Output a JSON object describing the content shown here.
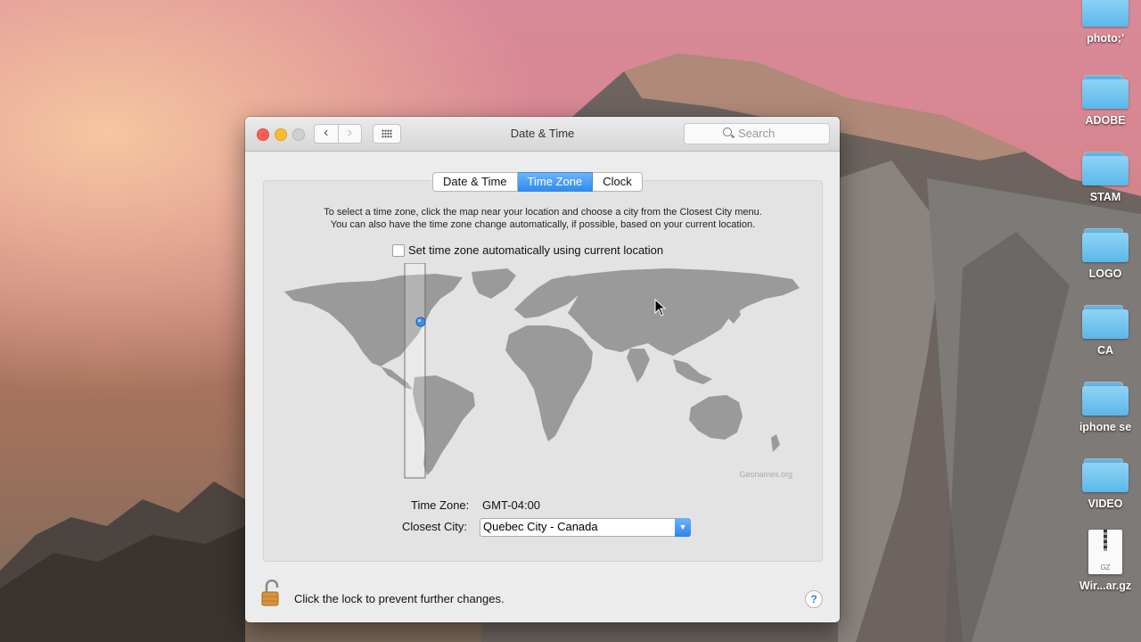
{
  "desktop": {
    "icons": [
      {
        "label": "photo;'",
        "kind": "folder"
      },
      {
        "label": "ADOBE",
        "kind": "folder"
      },
      {
        "label": "STAM",
        "kind": "folder"
      },
      {
        "label": "LOGO",
        "kind": "folder"
      },
      {
        "label": "CA",
        "kind": "folder"
      },
      {
        "label": "iphone se",
        "kind": "folder"
      },
      {
        "label": "VIDEO",
        "kind": "folder"
      },
      {
        "label": "Wir...ar.gz",
        "kind": "gz-file",
        "badge": "GZ"
      }
    ]
  },
  "window": {
    "title": "Date & Time",
    "search_placeholder": "Search",
    "tabs": [
      {
        "label": "Date & Time",
        "active": false
      },
      {
        "label": "Time Zone",
        "active": true
      },
      {
        "label": "Clock",
        "active": false
      }
    ],
    "instructions_line1": "To select a time zone, click the map near your location and choose a city from the Closest City menu.",
    "instructions_line2": "You can also have the time zone change automatically, if possible, based on your current location.",
    "auto_timezone_label": "Set time zone automatically using current location",
    "auto_timezone_checked": false,
    "map_credit": "Geonames.org",
    "time_zone_label": "Time Zone:",
    "time_zone_value": "GMT-04:00",
    "closest_city_label": "Closest City:",
    "closest_city_value": "Quebec City - Canada",
    "lock_text": "Click the lock to prevent further changes.",
    "help_label": "?"
  },
  "colors": {
    "accent": "#2e8cf0",
    "close": "#fc5f57",
    "minimize": "#fdbc2e",
    "folder": "#5bb8ea"
  }
}
